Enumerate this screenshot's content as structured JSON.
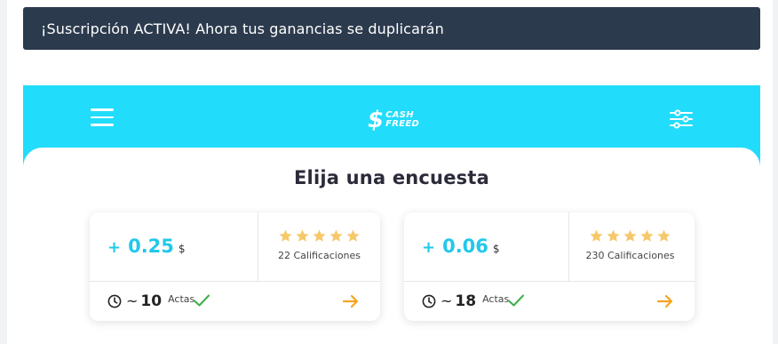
{
  "notice": {
    "text": "¡Suscripción ACTIVA! Ahora tus ganancias se duplicarán"
  },
  "header": {
    "logo_line1": "CASH",
    "logo_line2": "FREED",
    "logo_symbol": "$"
  },
  "content": {
    "title": "Elija una encuesta"
  },
  "colors": {
    "notice_bg": "#2c3a4d",
    "brand": "#22dcfb",
    "reward": "#22c8ea",
    "star": "#f6c86a",
    "check": "#3fae49",
    "arrow": "#f3a51c"
  },
  "surveys": [
    {
      "plus": "+",
      "reward": "0.25",
      "currency": "$",
      "rating_stars": 5,
      "ratings_label": "22 Calificaciones",
      "tilde": "~",
      "minutes": "10",
      "unit": "Actas"
    },
    {
      "plus": "+",
      "reward": "0.06",
      "currency": "$",
      "rating_stars": 5,
      "ratings_label": "230 Calificaciones",
      "tilde": "~",
      "minutes": "18",
      "unit": "Actas"
    }
  ],
  "icons": {
    "menu": "hamburger-menu-icon",
    "filter": "sliders-icon",
    "clock": "clock-icon",
    "check": "checkmark-icon",
    "arrow": "arrow-right-icon",
    "star": "star-icon"
  }
}
